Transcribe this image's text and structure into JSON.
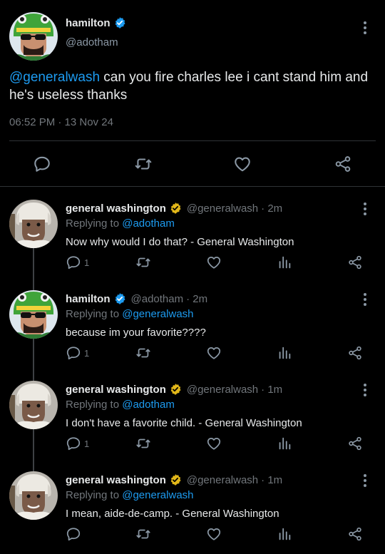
{
  "colors": {
    "background": "#000000",
    "text": "#e7e9ea",
    "muted": "#71767b",
    "link": "#1d9bf0",
    "verified_blue": "#1d9bf0",
    "verified_gold": "#e2b719"
  },
  "main_tweet": {
    "name": "hamilton",
    "handle": "@adotham",
    "mention": "@generalwash",
    "text": " can you fire charles lee i cant stand him and he's useless thanks",
    "timestamp": "06:52 PM · 13 Nov 24",
    "icons": [
      "reply-icon",
      "retweet-icon",
      "like-icon",
      "share-icon"
    ]
  },
  "replies": [
    {
      "name": "general washington",
      "handle": "@generalwash",
      "time": "· 2m",
      "replying_label": "Replying to ",
      "replying_to": "@adotham",
      "text": "Now why would I do that? - General Washington",
      "reply_count": "1",
      "verified": "gold"
    },
    {
      "name": "hamilton",
      "handle": "@adotham",
      "time": "· 2m",
      "replying_label": "Replying to ",
      "replying_to": "@generalwash",
      "text": "because im your favorite????",
      "reply_count": "1",
      "verified": "blue"
    },
    {
      "name": "general washington",
      "handle": "@generalwash",
      "time": "· 1m",
      "replying_label": "Replying to ",
      "replying_to": "@adotham",
      "text": "I don't have a favorite child. - General Washington",
      "reply_count": "1",
      "verified": "gold"
    },
    {
      "name": "general washington",
      "handle": "@generalwash",
      "time": "· 1m",
      "replying_label": "Replying to ",
      "replying_to": "@generalwash",
      "text": "I mean, aide-de-camp. - General Washington",
      "reply_count": "",
      "verified": "gold"
    }
  ]
}
